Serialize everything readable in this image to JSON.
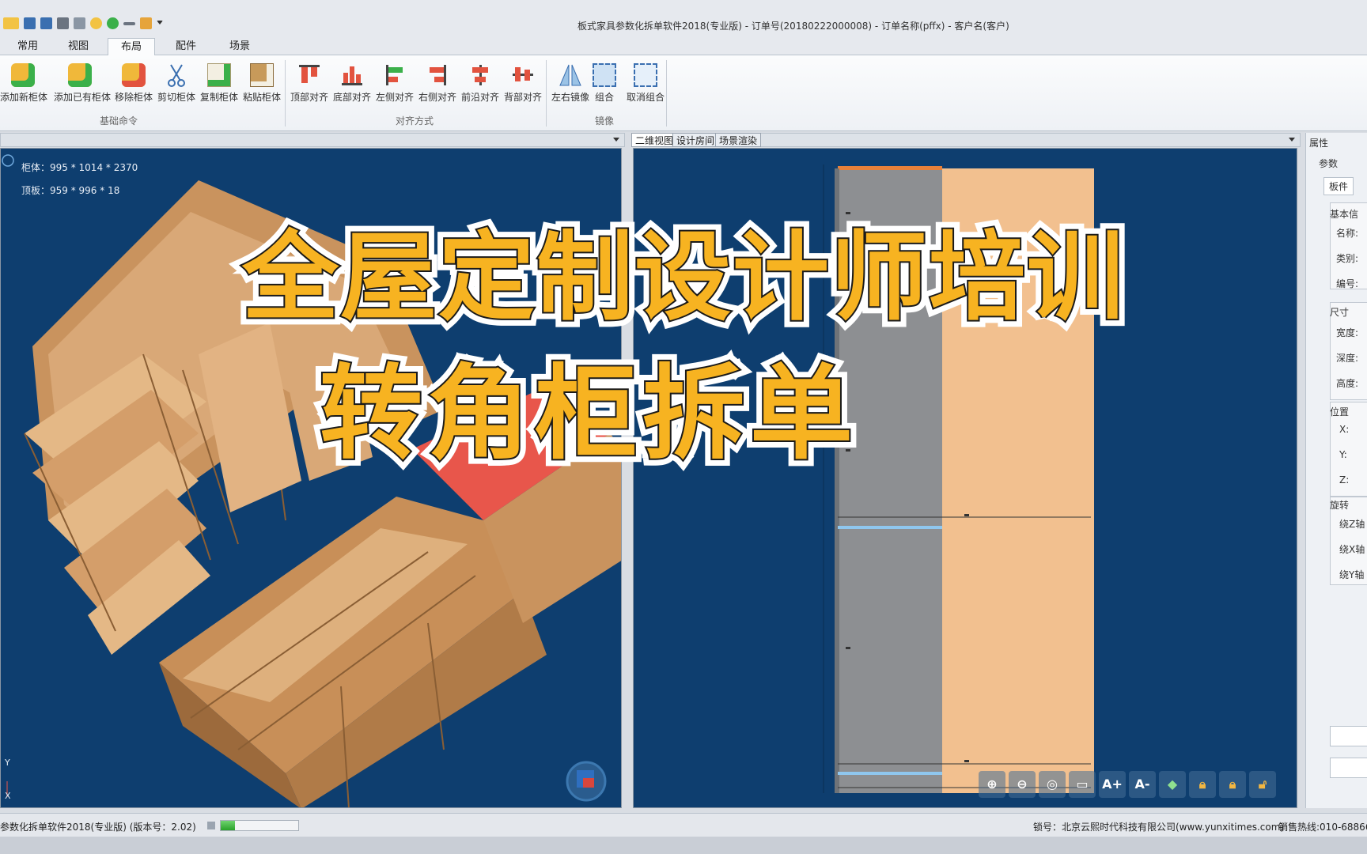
{
  "window": {
    "title": "板式家具参数化拆单软件2018(专业版) - 订单号(20180222000008) - 订单名称(pffx) - 客户名(客户)"
  },
  "ribbon": {
    "tabs": [
      "常用",
      "视图",
      "布局",
      "配件",
      "场景"
    ],
    "active_tab": "布局",
    "groups": [
      {
        "label": "基础命令",
        "buttons": [
          "添加新柜体",
          "添加已有柜体",
          "移除柜体",
          "剪切柜体",
          "复制柜体",
          "粘贴柜体"
        ]
      },
      {
        "label": "对齐方式",
        "buttons": [
          "顶部对齐",
          "底部对齐",
          "左侧对齐",
          "右侧对齐",
          "前沿对齐",
          "背部对齐"
        ]
      },
      {
        "label": "镜像",
        "buttons": [
          "左右镜像",
          "组合",
          "取消组合"
        ]
      }
    ]
  },
  "left_view": {
    "cabinet_dims": "柜体：995 * 1014 * 2370",
    "panel_dims": "顶板：959 * 996 * 18",
    "axis_y": "Y",
    "axis_x": "X"
  },
  "right_view": {
    "tabs": [
      "二维视图",
      "设计房间",
      "场景渲染"
    ],
    "active_tab": "二维视图",
    "zoom_buttons": [
      "A+",
      "A-"
    ]
  },
  "properties": {
    "title": "属性",
    "params_label": "参数",
    "tab": "板件",
    "sections": {
      "basic": "基本信",
      "size": "尺寸",
      "position": "位置",
      "rotation": "旋转"
    },
    "fields": {
      "name": "名称:",
      "category": "类别:",
      "code": "编号:",
      "width": "宽度:",
      "depth": "深度:",
      "height": "高度:",
      "x": "X:",
      "y": "Y:",
      "z": "Z:",
      "rot_z": "绕Z轴",
      "rot_x": "绕X轴",
      "rot_y": "绕Y轴"
    }
  },
  "status": {
    "version": "参数化拆单软件2018(专业版) (版本号：2.02)",
    "progress": 0.18,
    "company": "锁号：北京云熙时代科技有限公司(www.yunxitimes.com)",
    "hotline": "销售热线:010-68866"
  },
  "overlay": {
    "line1": "全屋定制设计师培训",
    "line2": "转角柜拆单"
  },
  "colors": {
    "viewport_bg": "#0e3e6f",
    "wood": "#d9a877",
    "highlight": "#e8564b",
    "banner": "#f7b321"
  }
}
